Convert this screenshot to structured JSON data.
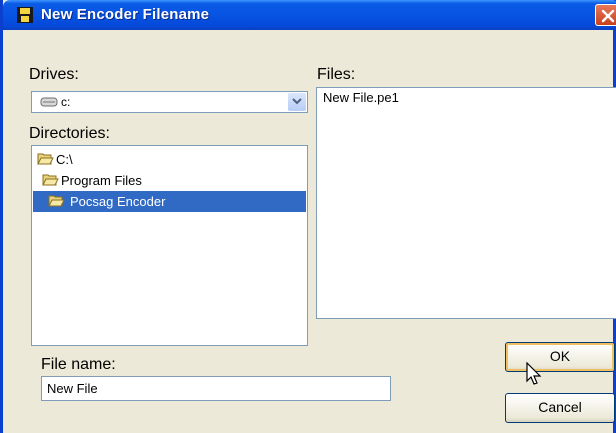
{
  "window": {
    "title": "New Encoder Filename"
  },
  "drives": {
    "label": "Drives:",
    "selected": "c:",
    "icon": "drive-icon"
  },
  "directories": {
    "label": "Directories:",
    "items": [
      {
        "label": "C:\\",
        "icon": "folder-open-icon",
        "selected": false
      },
      {
        "label": "Program Files",
        "icon": "folder-open-icon",
        "selected": false
      },
      {
        "label": "Pocsag Encoder",
        "icon": "folder-open-icon",
        "selected": true
      }
    ]
  },
  "files": {
    "label": "Files:",
    "items": [
      "New File.pe1"
    ]
  },
  "filename": {
    "label": "File name:",
    "value": "New File"
  },
  "buttons": {
    "ok": "OK",
    "cancel": "Cancel"
  },
  "colors": {
    "titlebar": "#0854e3",
    "selection": "#316ac5",
    "dialog_bg": "#ece9d8",
    "close_button": "#c8401c"
  }
}
